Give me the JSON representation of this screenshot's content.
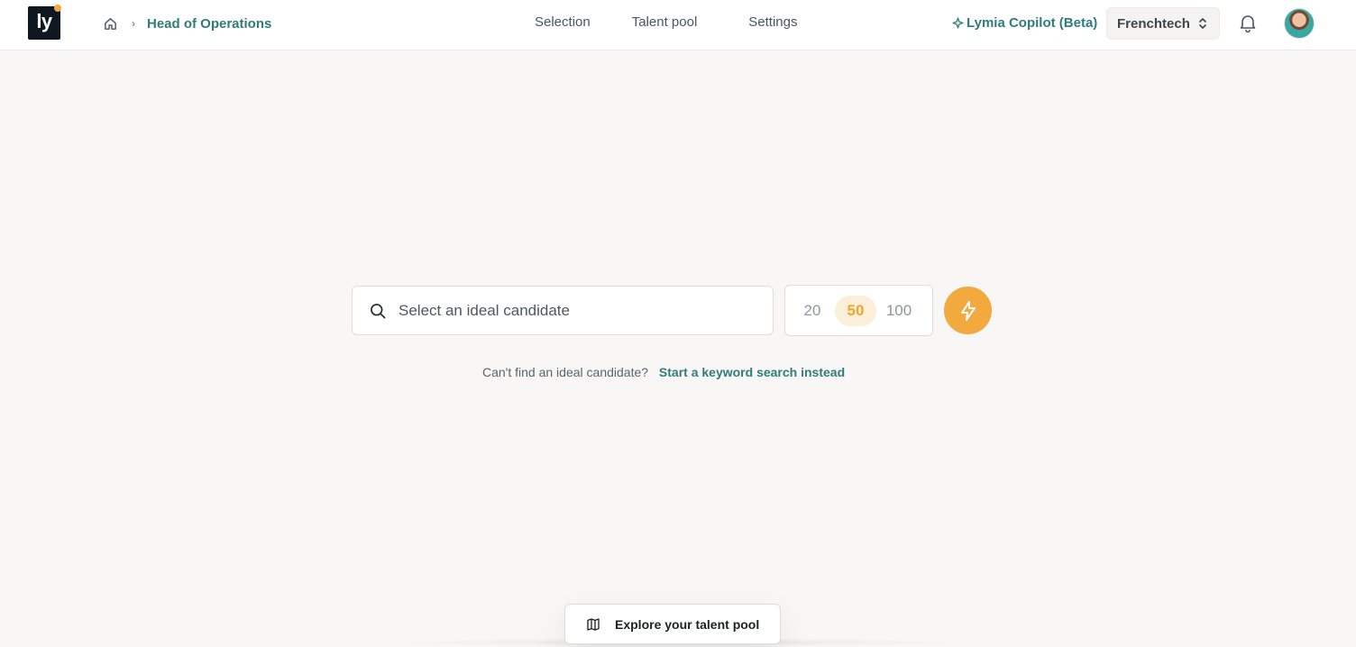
{
  "logo": {
    "text": "ly"
  },
  "breadcrumb": {
    "current": "Head of Operations",
    "separator": "›"
  },
  "nav": {
    "items": [
      "Selection",
      "Talent pool",
      "Settings"
    ]
  },
  "copilot": {
    "label": "Lymia Copilot (Beta)"
  },
  "workspace": {
    "name": "Frenchtech"
  },
  "search": {
    "placeholder": "Select an ideal candidate",
    "value": ""
  },
  "count": {
    "options": [
      "20",
      "50",
      "100"
    ],
    "selected": "50"
  },
  "hint": {
    "text": "Can't find an ideal candidate?",
    "link": "Start a keyword search instead"
  },
  "explore": {
    "label": "Explore your talent pool"
  },
  "icons": {
    "home": "home-icon",
    "search": "search-icon",
    "bolt": "bolt-icon",
    "bell": "bell-icon",
    "map": "map-icon",
    "copilot": "sparkle-icon",
    "switcher": "chevron-up-down-icon"
  },
  "colors": {
    "accent": "#2f7c7a",
    "brand": "#f2a93d",
    "background": "#f8f7f5"
  }
}
